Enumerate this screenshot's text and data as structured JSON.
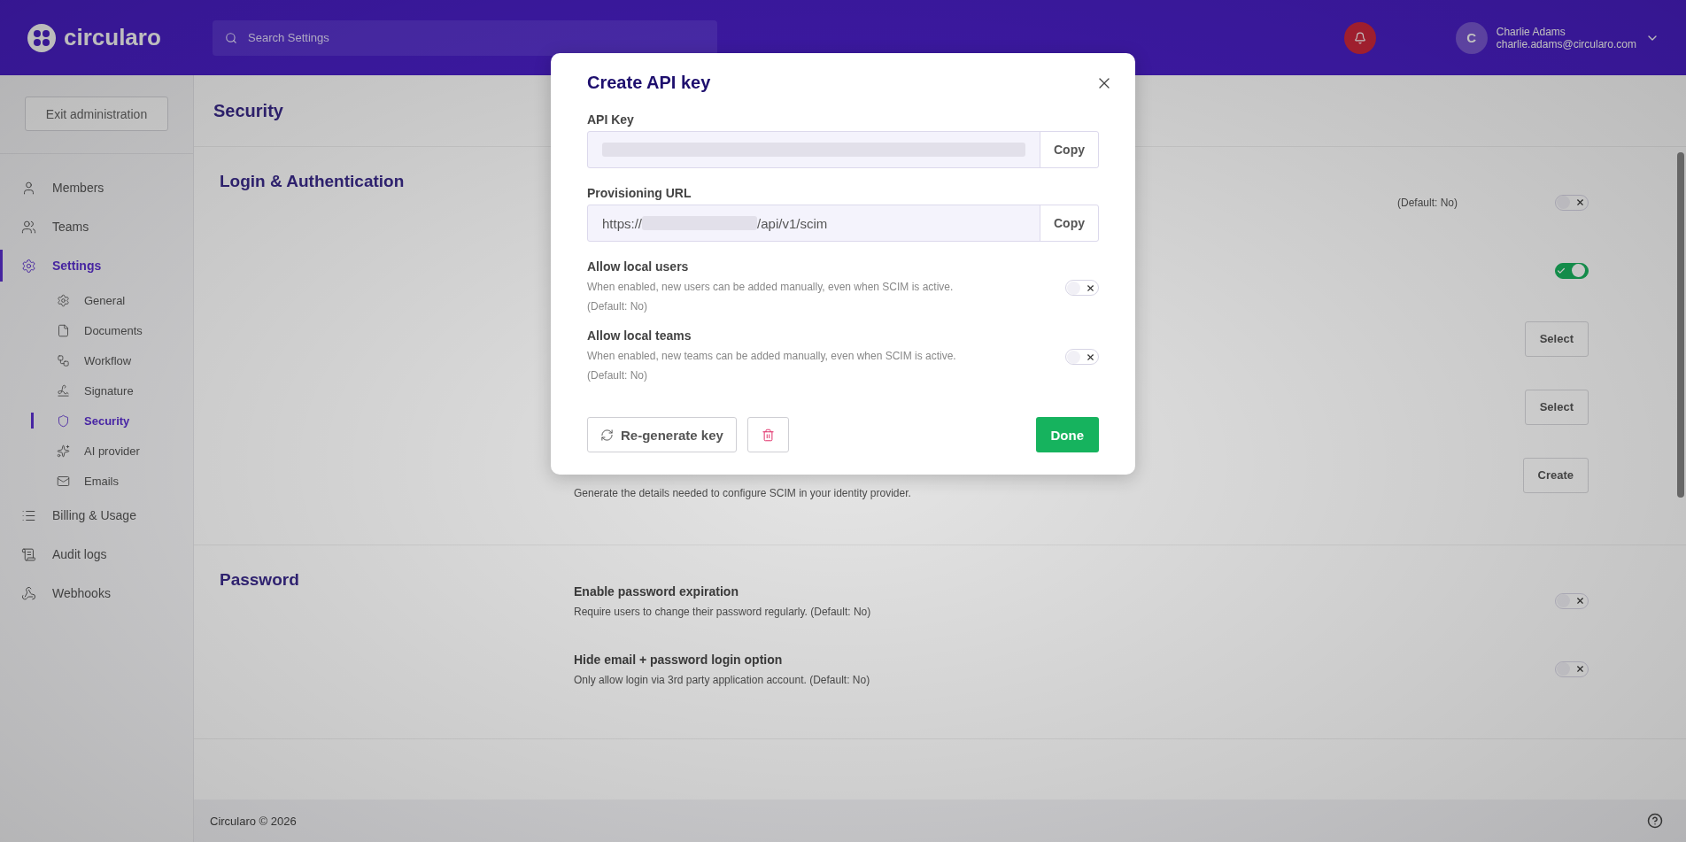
{
  "top_bar": {
    "logo": "circularo",
    "search": {
      "placeholder": "Search Settings"
    },
    "user": {
      "initial": "C",
      "name": "Charlie Adams",
      "email": "charlie.adams@circularo.com"
    }
  },
  "sidebar": {
    "exit_button": "Exit administration",
    "items": [
      {
        "label": "Members",
        "selected": false
      },
      {
        "label": "Teams",
        "selected": false
      },
      {
        "label": "Settings",
        "selected": true,
        "children": [
          {
            "label": "General",
            "selected": false
          },
          {
            "label": "Documents",
            "selected": false
          },
          {
            "label": "Workflow",
            "selected": false
          },
          {
            "label": "Signature",
            "selected": false
          },
          {
            "label": "Security",
            "selected": true
          },
          {
            "label": "AI provider",
            "selected": false
          },
          {
            "label": "Emails",
            "selected": false
          }
        ]
      },
      {
        "label": "Billing & Usage",
        "selected": false
      },
      {
        "label": "Audit logs",
        "selected": false
      },
      {
        "label": "Webhooks",
        "selected": false
      }
    ]
  },
  "page": {
    "title": "Security",
    "sections": [
      {
        "title": "Login & Authentication",
        "rows": [
          {
            "kind": "toggle",
            "note": "(Default: No)",
            "on": false
          },
          {
            "kind": "toggle",
            "on": true
          },
          {
            "kind": "button",
            "button": "Select"
          },
          {
            "kind": "button",
            "button": "Select"
          },
          {
            "kind": "button",
            "button": "Create",
            "description": "Generate the details needed to configure SCIM in your identity provider."
          }
        ]
      },
      {
        "title": "Password",
        "rows": [
          {
            "kind": "toggle",
            "label": "Enable password expiration",
            "description": "Require users to change their password regularly. (Default: No)",
            "on": false
          },
          {
            "kind": "toggle",
            "label": "Hide email + password login option",
            "description": "Only allow login via 3rd party application account. (Default: No)",
            "on": false
          }
        ]
      }
    ]
  },
  "footer": {
    "copyright": "Circularo © 2026"
  },
  "dialog": {
    "title": "Create API key",
    "fields": [
      {
        "label": "API Key",
        "button": "Copy"
      },
      {
        "label": "Provisioning URL",
        "value_start": "https://",
        "value_end": "/api/v1/scim",
        "button": "Copy"
      }
    ],
    "options": [
      {
        "label": "Allow local users",
        "description": "When enabled, new users can be added manually, even when SCIM is active.",
        "note": "(Default: No)",
        "on": false
      },
      {
        "label": "Allow local teams",
        "description": "When enabled, new teams can be added manually, even when SCIM is active.",
        "note": "(Default: No)",
        "on": false
      }
    ],
    "regenerate_button": "Re-generate key",
    "done_button": "Done"
  }
}
